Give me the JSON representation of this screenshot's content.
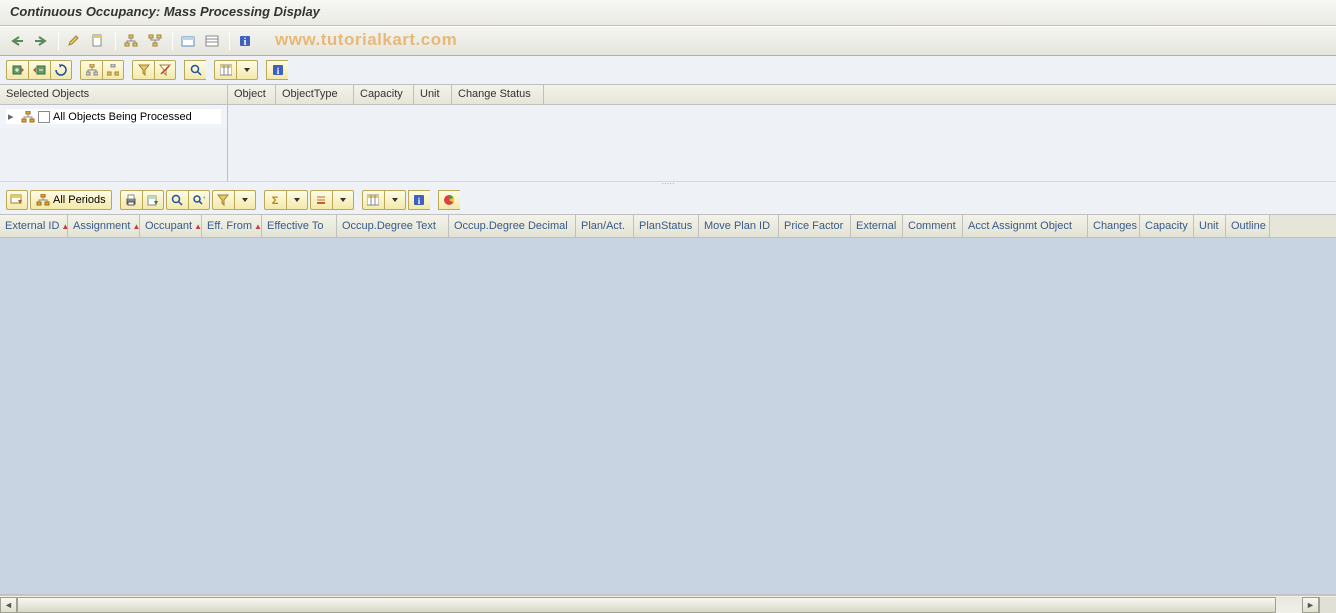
{
  "title": "Continuous Occupancy: Mass Processing Display",
  "watermark": "www.tutorialkart.com",
  "tree": {
    "header": "Selected Objects",
    "columns": [
      "Object",
      "ObjectType",
      "Capacity",
      "Unit",
      "Change Status"
    ],
    "root_label": "All Objects Being Processed"
  },
  "alv": {
    "all_periods_label": "All Periods",
    "columns": [
      {
        "label": "External ID",
        "sort": true,
        "w": 68
      },
      {
        "label": "Assignment",
        "sort": true,
        "w": 72
      },
      {
        "label": "Occupant",
        "sort": true,
        "w": 62
      },
      {
        "label": "Eff. From",
        "sort": true,
        "w": 60
      },
      {
        "label": "Effective To",
        "sort": false,
        "w": 75
      },
      {
        "label": "Occup.Degree Text",
        "sort": false,
        "w": 112
      },
      {
        "label": "Occup.Degree Decimal",
        "sort": false,
        "w": 127
      },
      {
        "label": "Plan/Act.",
        "sort": false,
        "w": 58
      },
      {
        "label": "PlanStatus",
        "sort": false,
        "w": 65
      },
      {
        "label": "Move Plan ID",
        "sort": false,
        "w": 80
      },
      {
        "label": "Price Factor",
        "sort": false,
        "w": 72
      },
      {
        "label": "External",
        "sort": false,
        "w": 52
      },
      {
        "label": "Comment",
        "sort": false,
        "w": 60
      },
      {
        "label": "Acct Assignmt Object",
        "sort": false,
        "w": 125
      },
      {
        "label": "Changes",
        "sort": false,
        "w": 52
      },
      {
        "label": "Capacity",
        "sort": false,
        "w": 54
      },
      {
        "label": "Unit",
        "sort": false,
        "w": 32
      },
      {
        "label": "Outline",
        "sort": false,
        "w": 44
      }
    ]
  }
}
